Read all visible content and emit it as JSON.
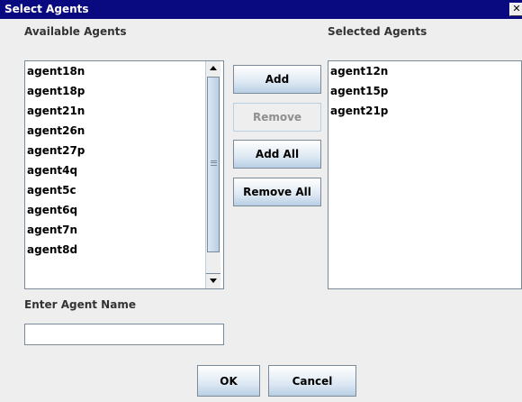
{
  "window": {
    "title": "Select Agents",
    "close_glyph": "✕"
  },
  "available": {
    "label": "Available Agents",
    "items": [
      "agent18n",
      "agent18p",
      "agent21n",
      "agent26n",
      "agent27p",
      "agent4q",
      "agent5c",
      "agent6q",
      "agent7n",
      "agent8d"
    ]
  },
  "selected": {
    "label": "Selected Agents",
    "items": [
      "agent12n",
      "agent15p",
      "agent21p"
    ]
  },
  "buttons": {
    "add": "Add",
    "remove": "Remove",
    "add_all": "Add All",
    "remove_all": "Remove All",
    "ok": "OK",
    "cancel": "Cancel"
  },
  "name_entry": {
    "label": "Enter Agent Name",
    "value": ""
  }
}
